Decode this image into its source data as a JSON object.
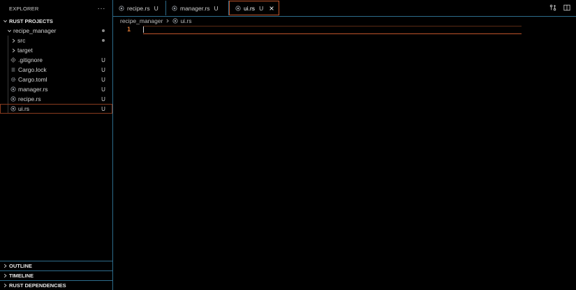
{
  "explorer": {
    "title": "EXPLORER",
    "more_label": "···",
    "workspace": "RUST PROJECTS",
    "tree": [
      {
        "name": "recipe_manager",
        "kind": "folder-open",
        "indent": 1,
        "status": "dot"
      },
      {
        "name": "src",
        "kind": "folder",
        "indent": 2,
        "status": "dot"
      },
      {
        "name": "target",
        "kind": "folder",
        "indent": 2,
        "status": ""
      },
      {
        "name": ".gitignore",
        "kind": "gitignore",
        "indent": 2,
        "status": "U"
      },
      {
        "name": "Cargo.lock",
        "kind": "lock",
        "indent": 2,
        "status": "U"
      },
      {
        "name": "Cargo.toml",
        "kind": "toml",
        "indent": 2,
        "status": "U"
      },
      {
        "name": "manager.rs",
        "kind": "rust",
        "indent": 2,
        "status": "U"
      },
      {
        "name": "recipe.rs",
        "kind": "rust",
        "indent": 2,
        "status": "U"
      },
      {
        "name": "ui.rs",
        "kind": "rust",
        "indent": 2,
        "status": "U",
        "selected": true
      }
    ],
    "bottom_sections": [
      "OUTLINE",
      "TIMELINE",
      "RUST DEPENDENCIES"
    ]
  },
  "tabs": [
    {
      "label": "recipe.rs",
      "badge": "U",
      "active": false
    },
    {
      "label": "manager.rs",
      "badge": "U",
      "active": false
    },
    {
      "label": "ui.rs",
      "badge": "U",
      "active": true
    }
  ],
  "breadcrumb": {
    "folder": "recipe_manager",
    "file": "ui.rs"
  },
  "editor": {
    "line_number": "1"
  },
  "colors": {
    "accent": "#c0542a",
    "border": "#2d6c8c",
    "line_number": "#e07b35"
  }
}
